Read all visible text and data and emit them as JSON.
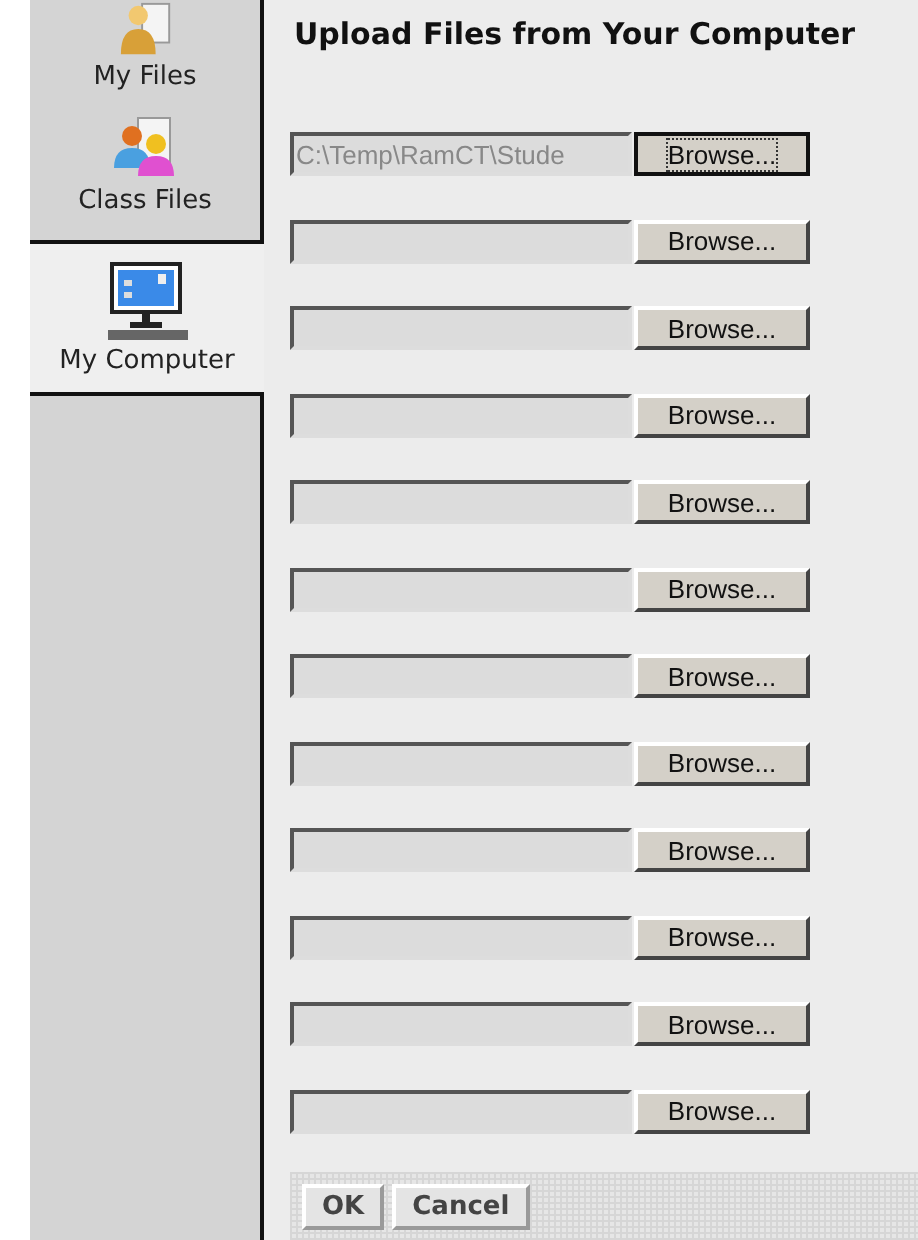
{
  "sidebar": {
    "items": [
      {
        "label": "My Files",
        "kind": "files",
        "selected": false
      },
      {
        "label": "Class Files",
        "kind": "class",
        "selected": false
      },
      {
        "label": "My Computer",
        "kind": "computer",
        "selected": true
      }
    ]
  },
  "title": "Upload Files from Your Computer",
  "file_rows": [
    {
      "value": "C:\\Temp\\RamCT\\Stude",
      "button": "Browse...",
      "focused": true
    },
    {
      "button": "Browse...",
      "focused": false
    },
    {
      "button": "Browse...",
      "focused": false
    },
    {
      "button": "Browse...",
      "focused": false
    },
    {
      "button": "Browse...",
      "focused": false
    },
    {
      "button": "Browse...",
      "focused": false
    },
    {
      "button": "Browse...",
      "focused": false
    },
    {
      "button": "Browse...",
      "focused": false
    },
    {
      "button": "Browse...",
      "focused": false
    },
    {
      "button": "Browse...",
      "focused": false
    },
    {
      "button": "Browse...",
      "focused": false
    },
    {
      "button": "Browse...",
      "focused": false
    }
  ],
  "buttons": [
    "OK",
    "Cancel"
  ]
}
